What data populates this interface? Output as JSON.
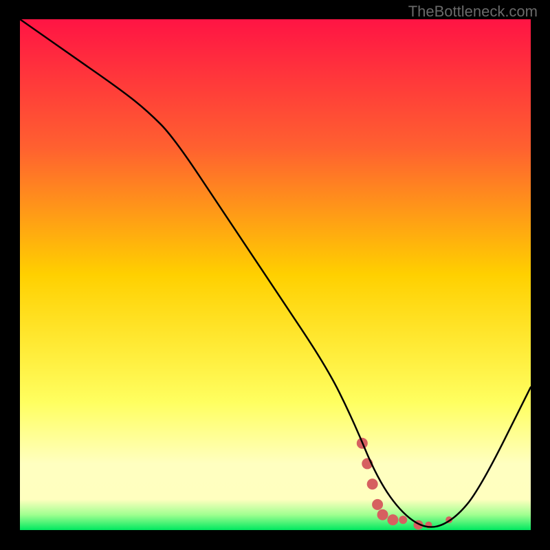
{
  "watermark": "TheBottleneck.com",
  "chart_data": {
    "type": "line",
    "title": "",
    "xlabel": "",
    "ylabel": "",
    "xlim": [
      0,
      100
    ],
    "ylim": [
      0,
      100
    ],
    "gradient_colors": [
      {
        "stop": 0,
        "color": "#ff1444"
      },
      {
        "stop": 0.25,
        "color": "#ff6030"
      },
      {
        "stop": 0.5,
        "color": "#ffd000"
      },
      {
        "stop": 0.75,
        "color": "#ffff60"
      },
      {
        "stop": 0.87,
        "color": "#ffffc0"
      },
      {
        "stop": 0.94,
        "color": "#ffffbf"
      },
      {
        "stop": 0.97,
        "color": "#a0ff90"
      },
      {
        "stop": 1.0,
        "color": "#00e860"
      }
    ],
    "series": [
      {
        "name": "main-curve",
        "color": "#000000",
        "x": [
          0,
          10,
          20,
          25,
          30,
          40,
          50,
          60,
          65,
          70,
          75,
          80,
          85,
          90,
          100
        ],
        "y": [
          100,
          93,
          86,
          82,
          77,
          62,
          47,
          32,
          22,
          10,
          3,
          0,
          2,
          8,
          28
        ]
      }
    ],
    "markers": {
      "name": "highlighted-points",
      "color": "#d66060",
      "points": [
        {
          "x": 67,
          "y": 17,
          "size": 8
        },
        {
          "x": 68,
          "y": 13,
          "size": 8
        },
        {
          "x": 69,
          "y": 9,
          "size": 8
        },
        {
          "x": 70,
          "y": 5,
          "size": 8
        },
        {
          "x": 71,
          "y": 3,
          "size": 8
        },
        {
          "x": 73,
          "y": 2,
          "size": 8
        },
        {
          "x": 75,
          "y": 2,
          "size": 6
        },
        {
          "x": 78,
          "y": 1,
          "size": 7
        },
        {
          "x": 80,
          "y": 1,
          "size": 5
        },
        {
          "x": 84,
          "y": 2,
          "size": 5
        }
      ]
    }
  }
}
